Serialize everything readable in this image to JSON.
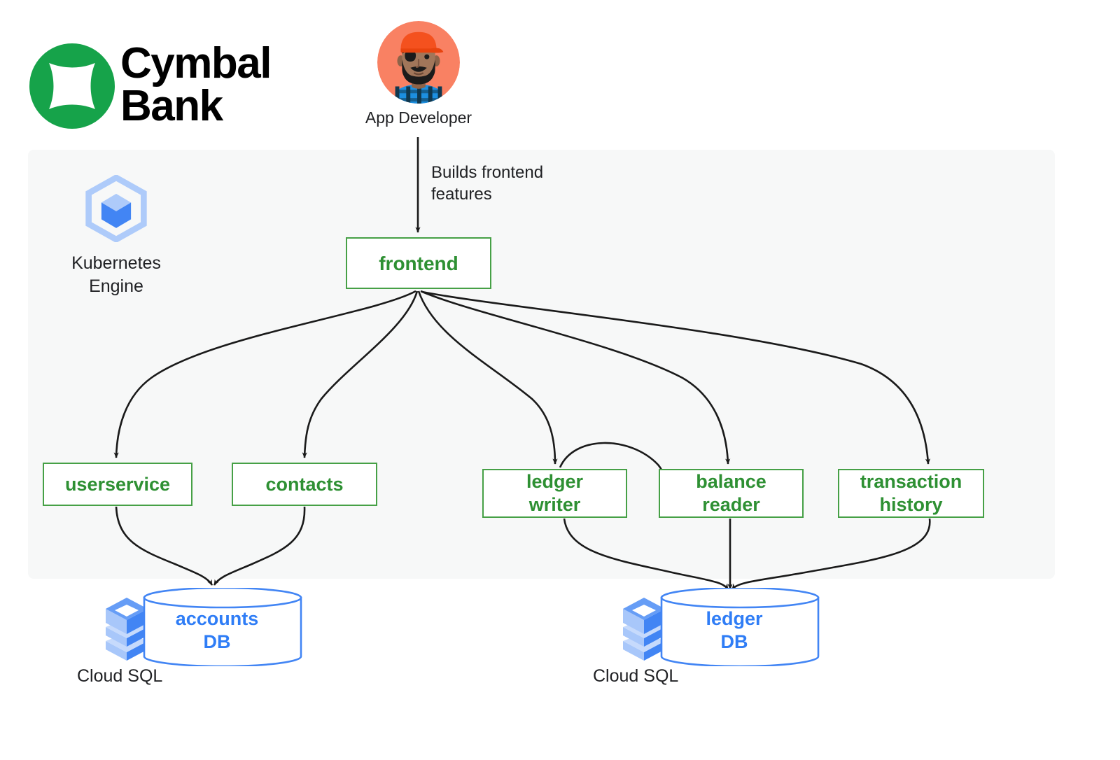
{
  "brand": {
    "name_line1": "Cymbal",
    "name_line2": "Bank",
    "logo_icon": "cymbal-star-logo",
    "logo_color": "#16A34A"
  },
  "actor": {
    "label": "App Developer",
    "avatar_icon": "developer-avatar",
    "avatar_bg_color": "#F98163",
    "cap_color": "#F4511E"
  },
  "platform": {
    "icon": "kubernetes-engine-icon",
    "label_line1": "Kubernetes",
    "label_line2": "Engine",
    "panel_color": "#F7F8F8",
    "icon_color": "#4285F4"
  },
  "edges": [
    {
      "from": "App Developer",
      "to": "frontend",
      "label_line1": "Builds frontend",
      "label_line2": "features"
    },
    {
      "from": "frontend",
      "to": "userservice",
      "label": ""
    },
    {
      "from": "frontend",
      "to": "contacts",
      "label": ""
    },
    {
      "from": "frontend",
      "to": "ledger writer",
      "label": ""
    },
    {
      "from": "frontend",
      "to": "balance reader",
      "label": ""
    },
    {
      "from": "frontend",
      "to": "transaction history",
      "label": ""
    },
    {
      "from": "ledger writer",
      "to": "balance reader",
      "label": ""
    },
    {
      "from": "userservice",
      "to": "accounts DB",
      "label": ""
    },
    {
      "from": "contacts",
      "to": "accounts DB",
      "label": ""
    },
    {
      "from": "ledger writer",
      "to": "ledger DB",
      "label": ""
    },
    {
      "from": "balance reader",
      "to": "ledger DB",
      "label": ""
    },
    {
      "from": "transaction history",
      "to": "ledger DB",
      "label": ""
    }
  ],
  "services": {
    "frontend": {
      "label": "frontend"
    },
    "userservice": {
      "label": "userservice"
    },
    "contacts": {
      "label": "contacts"
    },
    "ledger_writer": {
      "label_line1": "ledger",
      "label_line2": "writer"
    },
    "balance_reader": {
      "label_line1": "balance",
      "label_line2": "reader"
    },
    "transaction_history": {
      "label_line1": "transaction",
      "label_line2": "history"
    },
    "border_color": "#46A046",
    "text_color": "#2E9033"
  },
  "databases": {
    "accounts": {
      "label_line1": "accounts",
      "label_line2": "DB",
      "product_label": "Cloud SQL",
      "icon": "cloud-sql-icon",
      "color": "#2F7DF6"
    },
    "ledger": {
      "label_line1": "ledger",
      "label_line2": "DB",
      "product_label": "Cloud SQL",
      "icon": "cloud-sql-icon",
      "color": "#2F7DF6"
    }
  }
}
